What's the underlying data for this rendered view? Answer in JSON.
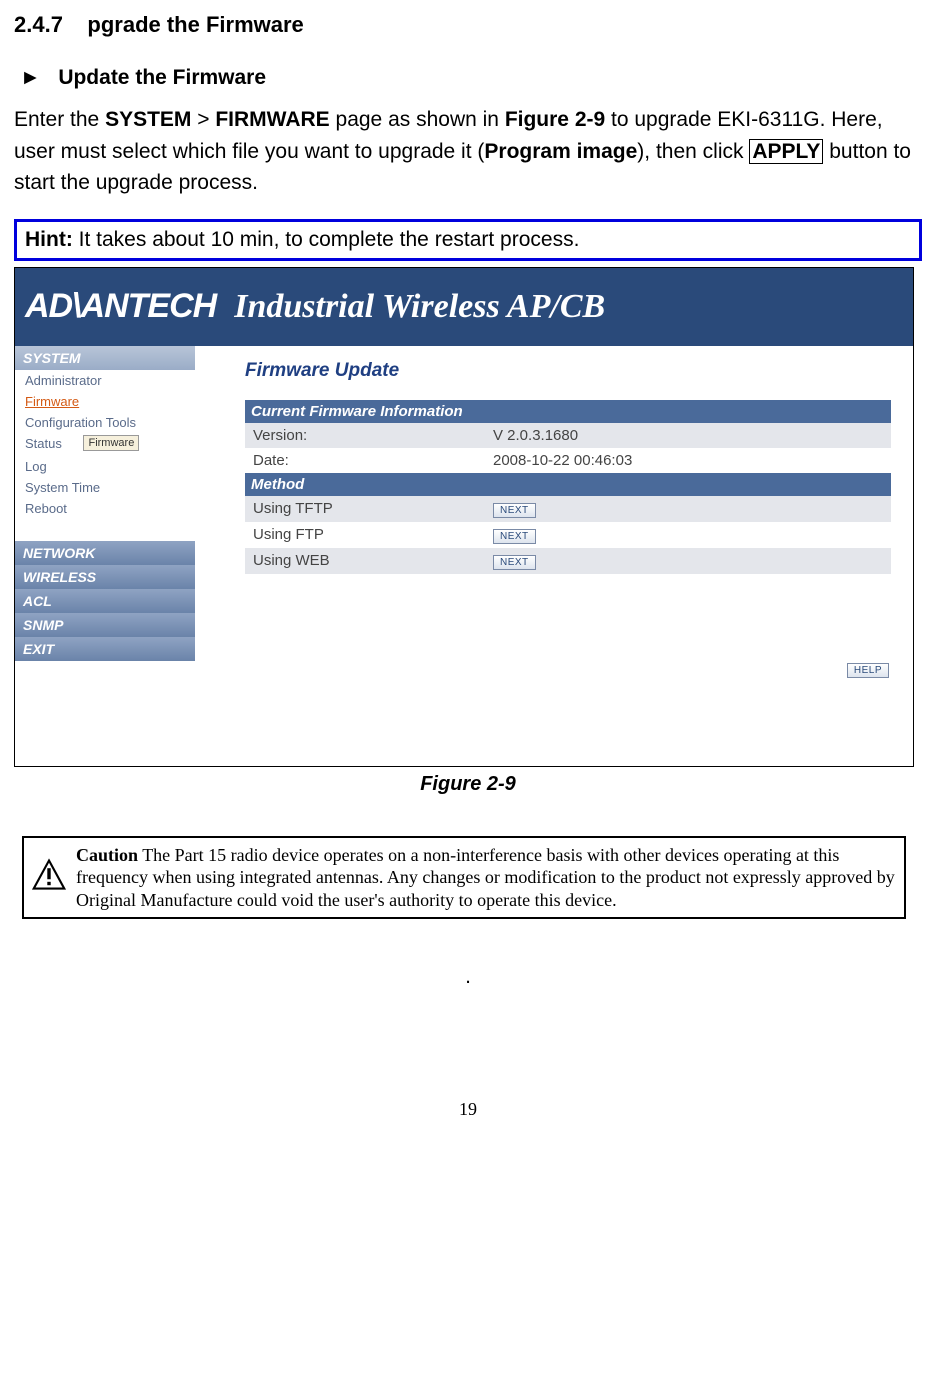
{
  "section": {
    "num": "2.4.7",
    "title": "pgrade the Firmware"
  },
  "subsection": {
    "marker": "►",
    "title": "Update the Firmware"
  },
  "para": {
    "t1": "Enter the ",
    "b1": "SYSTEM",
    "t2": " > ",
    "b2": "FIRMWARE",
    "t3": " page as shown in ",
    "b3": "Figure 2-9",
    "t4": " to upgrade EKI-6311G. Here, user must select which file you want to upgrade it (",
    "b4": "Program image",
    "t5": "), then click ",
    "apply": "APPLY",
    "t6": " button to start the upgrade process."
  },
  "hint": {
    "label": "Hint:",
    "text": " It takes about 10 min, to complete the restart process."
  },
  "screenshot": {
    "logo": "AD\\ANTECH",
    "banner": "Industrial Wireless AP/CB",
    "sidebar": {
      "cats": [
        "SYSTEM",
        "NETWORK",
        "WIRELESS",
        "ACL",
        "SNMP",
        "EXIT"
      ],
      "subs": [
        "Administrator",
        "Firmware",
        "Configuration Tools",
        "Status",
        "Log",
        "System Time",
        "Reboot"
      ],
      "tooltip": "Firmware"
    },
    "content": {
      "title": "Firmware Update",
      "section1": "Current Firmware Information",
      "version_l": "Version:",
      "version_v": "V 2.0.3.1680",
      "date_l": "Date:",
      "date_v": "2008-10-22 00:46:03",
      "section2": "Method",
      "m1": "Using TFTP",
      "m2": "Using FTP",
      "m3": "Using WEB",
      "next": "NEXT",
      "help": "HELP"
    }
  },
  "figure_caption": "Figure 2-9",
  "caution": {
    "label": "Caution",
    "text": "   The Part 15 radio device operates on a non-interference basis with other devices operating at this frequency when using integrated antennas.    Any changes or modification to the product not expressly approved by Original Manufacture could void the user's authority to operate this device."
  },
  "dot": ".",
  "page": "19"
}
